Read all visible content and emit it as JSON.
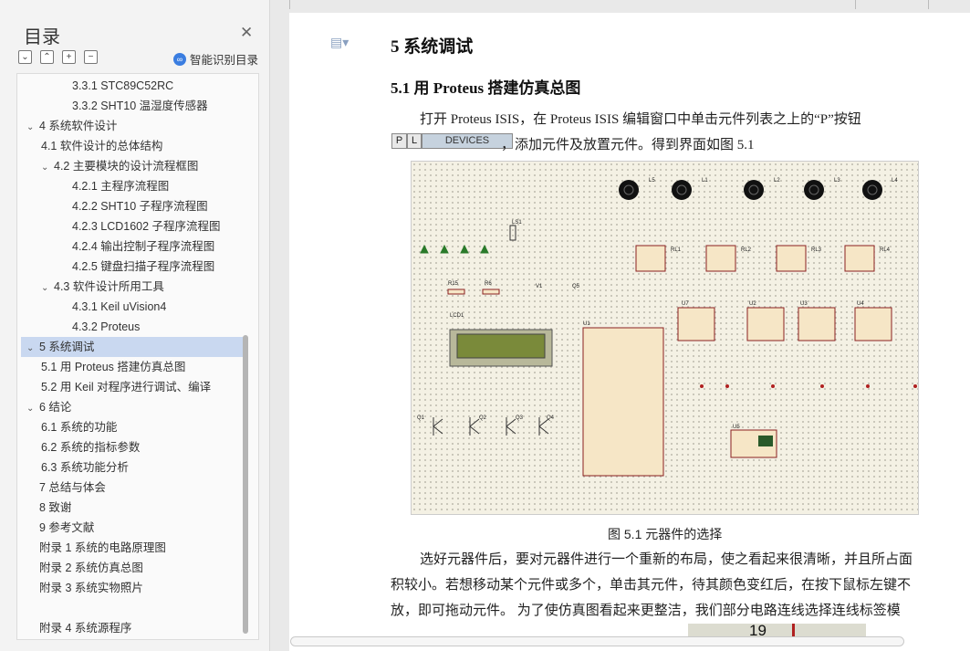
{
  "sidebar": {
    "title": "目录",
    "smart_toc": "智能识别目录",
    "tools": [
      "⌄",
      "⌃",
      "+",
      "−"
    ],
    "items": [
      {
        "label": "3.3.1 STC89C52RC",
        "level": 3,
        "chevron": ""
      },
      {
        "label": "3.3.2 SHT10 温湿度传感器",
        "level": 3,
        "chevron": ""
      },
      {
        "label": "4  系统软件设计",
        "level": 1,
        "chevron": "⌄"
      },
      {
        "label": "4.1  软件设计的总体结构",
        "level": 2,
        "chevron": ""
      },
      {
        "label": "4.2  主要模块的设计流程框图",
        "level": 2,
        "chevron": "⌄"
      },
      {
        "label": "4.2.1  主程序流程图",
        "level": 3,
        "chevron": ""
      },
      {
        "label": "4.2.2 SHT10 子程序流程图",
        "level": 3,
        "chevron": ""
      },
      {
        "label": "4.2.3 LCD1602 子程序流程图",
        "level": 3,
        "chevron": ""
      },
      {
        "label": "4.2.4  输出控制子程序流程图",
        "level": 3,
        "chevron": ""
      },
      {
        "label": "4.2.5  键盘扫描子程序流程图",
        "level": 3,
        "chevron": ""
      },
      {
        "label": "4.3  软件设计所用工具",
        "level": 2,
        "chevron": "⌄"
      },
      {
        "label": "4.3.1 Keil uVision4",
        "level": 3,
        "chevron": ""
      },
      {
        "label": "4.3.2 Proteus",
        "level": 3,
        "chevron": ""
      },
      {
        "label": "5  系统调试",
        "level": 1,
        "chevron": "⌄",
        "selected": true
      },
      {
        "label": "5.1  用 Proteus 搭建仿真总图",
        "level": 2,
        "chevron": ""
      },
      {
        "label": "5.2  用 Keil 对程序进行调试、编译",
        "level": 2,
        "chevron": ""
      },
      {
        "label": "6  结论",
        "level": 1,
        "chevron": "⌄"
      },
      {
        "label": "6.1  系统的功能",
        "level": 2,
        "chevron": ""
      },
      {
        "label": "6.2  系统的指标参数",
        "level": 2,
        "chevron": ""
      },
      {
        "label": "6.3  系统功能分析",
        "level": 2,
        "chevron": ""
      },
      {
        "label": "7  总结与体会",
        "level": 1,
        "chevron": ""
      },
      {
        "label": "8  致谢",
        "level": 1,
        "chevron": ""
      },
      {
        "label": "9  参考文献",
        "level": 1,
        "chevron": ""
      },
      {
        "label": "附录 1  系统的电路原理图",
        "level": 1,
        "chevron": ""
      },
      {
        "label": "附录 2  系统仿真总图",
        "level": 1,
        "chevron": ""
      },
      {
        "label": "附录 3  系统实物照片",
        "level": 1,
        "chevron": ""
      },
      {
        "label": "附录 4  系统源程序",
        "level": 1,
        "chevron": "",
        "gap": true
      }
    ]
  },
  "document": {
    "h1": "5  系统调试",
    "h2": "5.1  用 Proteus 搭建仿真总图",
    "para1_line1": "打开 Proteus ISIS，在  Proteus ISIS 编辑窗口中单击元件列表之上的“P”按钮",
    "para1_line2": "，添加元件及放置元件。得到界面如图 5.1",
    "pl_p": "P",
    "pl_l": "L",
    "pl_devices": "DEVICES",
    "caption": "图 5.1 元器件的选择",
    "para2_line1": "选好元器件后，要对元器件进行一个重新的布局，使之看起来很清晰，并且所占面",
    "para2_line2": "积较小。若想移动某个元件或多个，单击其元件，待其颜色变红后，在按下鼠标左键不",
    "para2_line3": "放，即可拖动元件。 为了使仿真图看起来更整洁，我们部分电路连线选择连线标签模",
    "bottom_fig_num": "19"
  },
  "schematic_labels": {
    "lamps": [
      "L5",
      "L1",
      "L2",
      "L3",
      "L4"
    ],
    "relays": [
      "RL1",
      "RL2",
      "RL3",
      "RL4"
    ],
    "optos": [
      "U7",
      "U2",
      "U3",
      "U4"
    ],
    "speaker": "LS1",
    "lcd": "LCD1",
    "mcu": "U1",
    "transistors": [
      "Q1",
      "Q2",
      "Q3",
      "Q4"
    ],
    "sensor": "U5",
    "misc": [
      "R15",
      "R6",
      "V1",
      "Q5"
    ]
  }
}
